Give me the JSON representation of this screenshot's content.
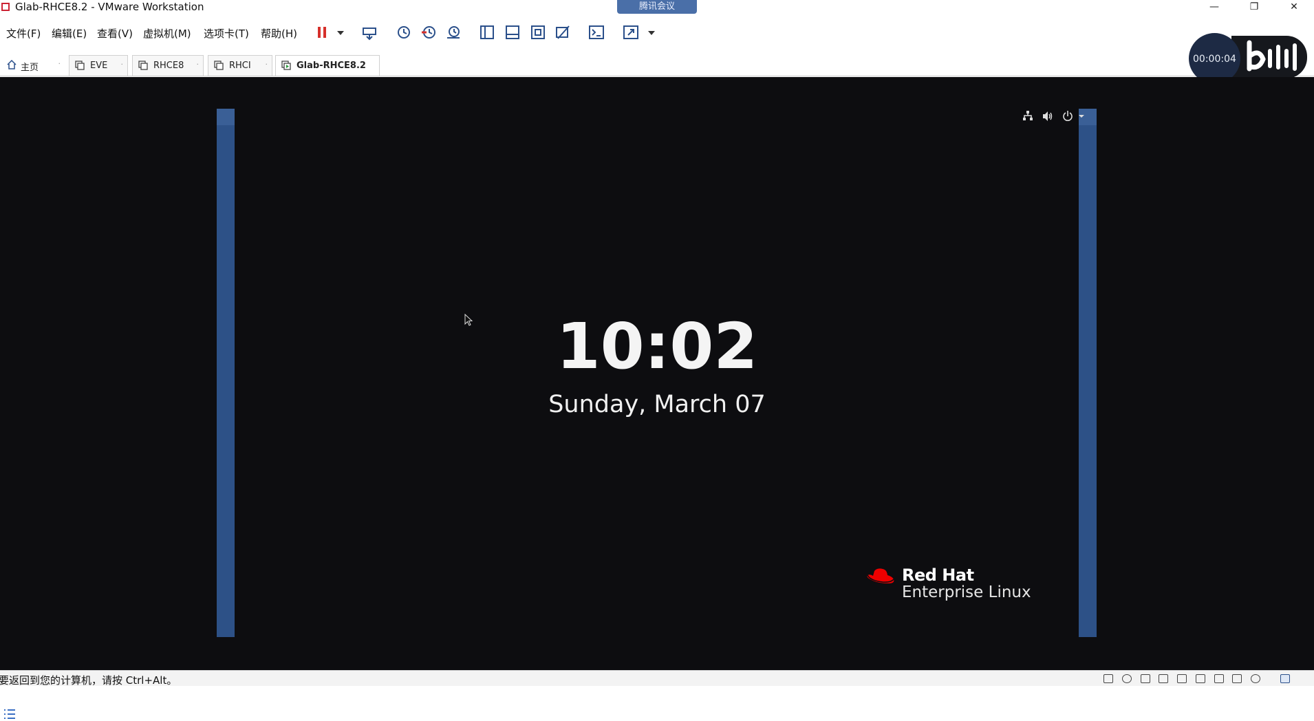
{
  "window": {
    "title": "Glab-RHCE8.2 - VMware Workstation",
    "meeting_badge": "腾讯会议",
    "minimize": "—",
    "restore": "❐",
    "close": "✕"
  },
  "menu": {
    "items": [
      "文件(F)",
      "编辑(E)",
      "查看(V)",
      "虚拟机(M)",
      "选项卡(T)",
      "帮助(H)"
    ]
  },
  "toolbar": {
    "icons": [
      "pause-icon",
      "dropdown-icon",
      "send-keys-icon",
      "snapshot-icon",
      "revert-snapshot-icon",
      "snapshot-manager-icon",
      "library-icon",
      "console-view-icon",
      "fit-guest-icon",
      "unity-icon",
      "terminal-icon",
      "fullscreen-icon"
    ]
  },
  "tabs": [
    {
      "label": "主页",
      "icon": "home-icon",
      "active": false
    },
    {
      "label": "EVE",
      "icon": "vm-icon",
      "active": false
    },
    {
      "label": "RHCE8",
      "icon": "vm-icon",
      "active": false
    },
    {
      "label": "RHCI",
      "icon": "vm-icon",
      "active": false
    },
    {
      "label": "Glab-RHCE8.2",
      "icon": "vm-running-icon",
      "active": true
    }
  ],
  "recorder": {
    "timer": "00:00:04"
  },
  "guest": {
    "time": "10:02",
    "date": "Sunday, March 07",
    "logo_line1": "Red Hat",
    "logo_line2": "Enterprise Linux",
    "status_icons": [
      "network-icon",
      "volume-icon",
      "power-icon",
      "menu-arrow-icon"
    ],
    "sidebar_color": "#2d5187",
    "background_color": "#0d0d10"
  },
  "statusbar": {
    "message": "要返回到您的计算机，请按 Ctrl+Alt。",
    "device_icons": [
      "hdd-icon",
      "cd-icon",
      "network-adapter-icon",
      "network-adapter-2-icon",
      "printer-icon",
      "sound-icon",
      "usb-icon",
      "display-icon",
      "message-icon",
      "fullscreen-icon"
    ]
  }
}
